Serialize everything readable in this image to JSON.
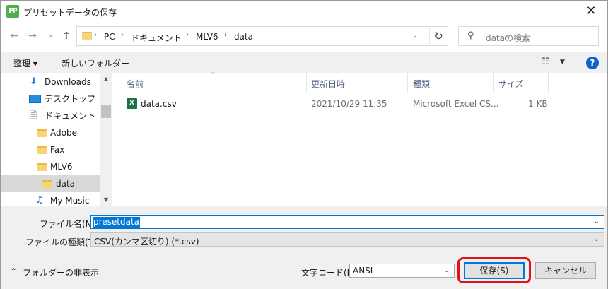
{
  "window": {
    "app_icon_text": "PP",
    "title": "プリセットデータの保存",
    "close_glyph": "✕"
  },
  "nav": {
    "back_glyph": "←",
    "forward_glyph": "→",
    "recent_glyph": "⌄",
    "up_glyph": "↑",
    "breadcrumbs": [
      "PC",
      "ドキュメント",
      "MLV6",
      "data"
    ],
    "sep_glyph": "›",
    "dropdown_glyph": "⌄",
    "refresh_glyph": "↻",
    "search_icon": "⚲",
    "search_placeholder": "dataの検索"
  },
  "toolbar": {
    "organize_label": "整理 ▾",
    "new_folder_label": "新しいフォルダー",
    "view_icon": "☷",
    "view_dropdown": "▼",
    "help_label": "?"
  },
  "sidebar": {
    "items": [
      {
        "label": "Downloads",
        "icon": "download-icon",
        "glyph": "⬇"
      },
      {
        "label": "デスクトップ",
        "icon": "desktop-icon",
        "glyph": ""
      },
      {
        "label": "ドキュメント",
        "icon": "document-icon",
        "glyph": "🗎"
      },
      {
        "label": "Adobe",
        "icon": "folder-icon",
        "glyph": ""
      },
      {
        "label": "Fax",
        "icon": "folder-icon",
        "glyph": ""
      },
      {
        "label": "MLV6",
        "icon": "folder-icon",
        "glyph": ""
      },
      {
        "label": "data",
        "icon": "folder-icon",
        "glyph": "",
        "selected": true
      },
      {
        "label": "My Music",
        "icon": "music-icon",
        "glyph": "♫"
      }
    ],
    "scroll_up": "▲",
    "scroll_down": "▼"
  },
  "filelist": {
    "sort_glyph": "^",
    "columns": [
      "名前",
      "更新日時",
      "種類",
      "サイズ"
    ],
    "rows": [
      {
        "icon": "excel-csv-icon",
        "icon_text": "X",
        "name": "data.csv",
        "modified": "2021/10/29 11:35",
        "type": "Microsoft Excel CS...",
        "size": "1 KB"
      }
    ]
  },
  "form": {
    "filename_label": "ファイル名(N):",
    "filename_value": "presetdata",
    "filetype_label": "ファイルの種類(T):",
    "filetype_value": "CSV(カンマ区切り) (*.csv)",
    "dropdown_glyph": "⌄",
    "hide_folders_label": "フォルダーの非表示",
    "hide_folders_glyph": "⌃",
    "encoding_label": "文字コード(E)",
    "encoding_value": "ANSI",
    "save_label": "保存(S)",
    "cancel_label": "キャンセル"
  },
  "colors": {
    "highlight_ring": "#e4121b",
    "accent": "#0078d7",
    "excel_green": "#1e7145"
  }
}
